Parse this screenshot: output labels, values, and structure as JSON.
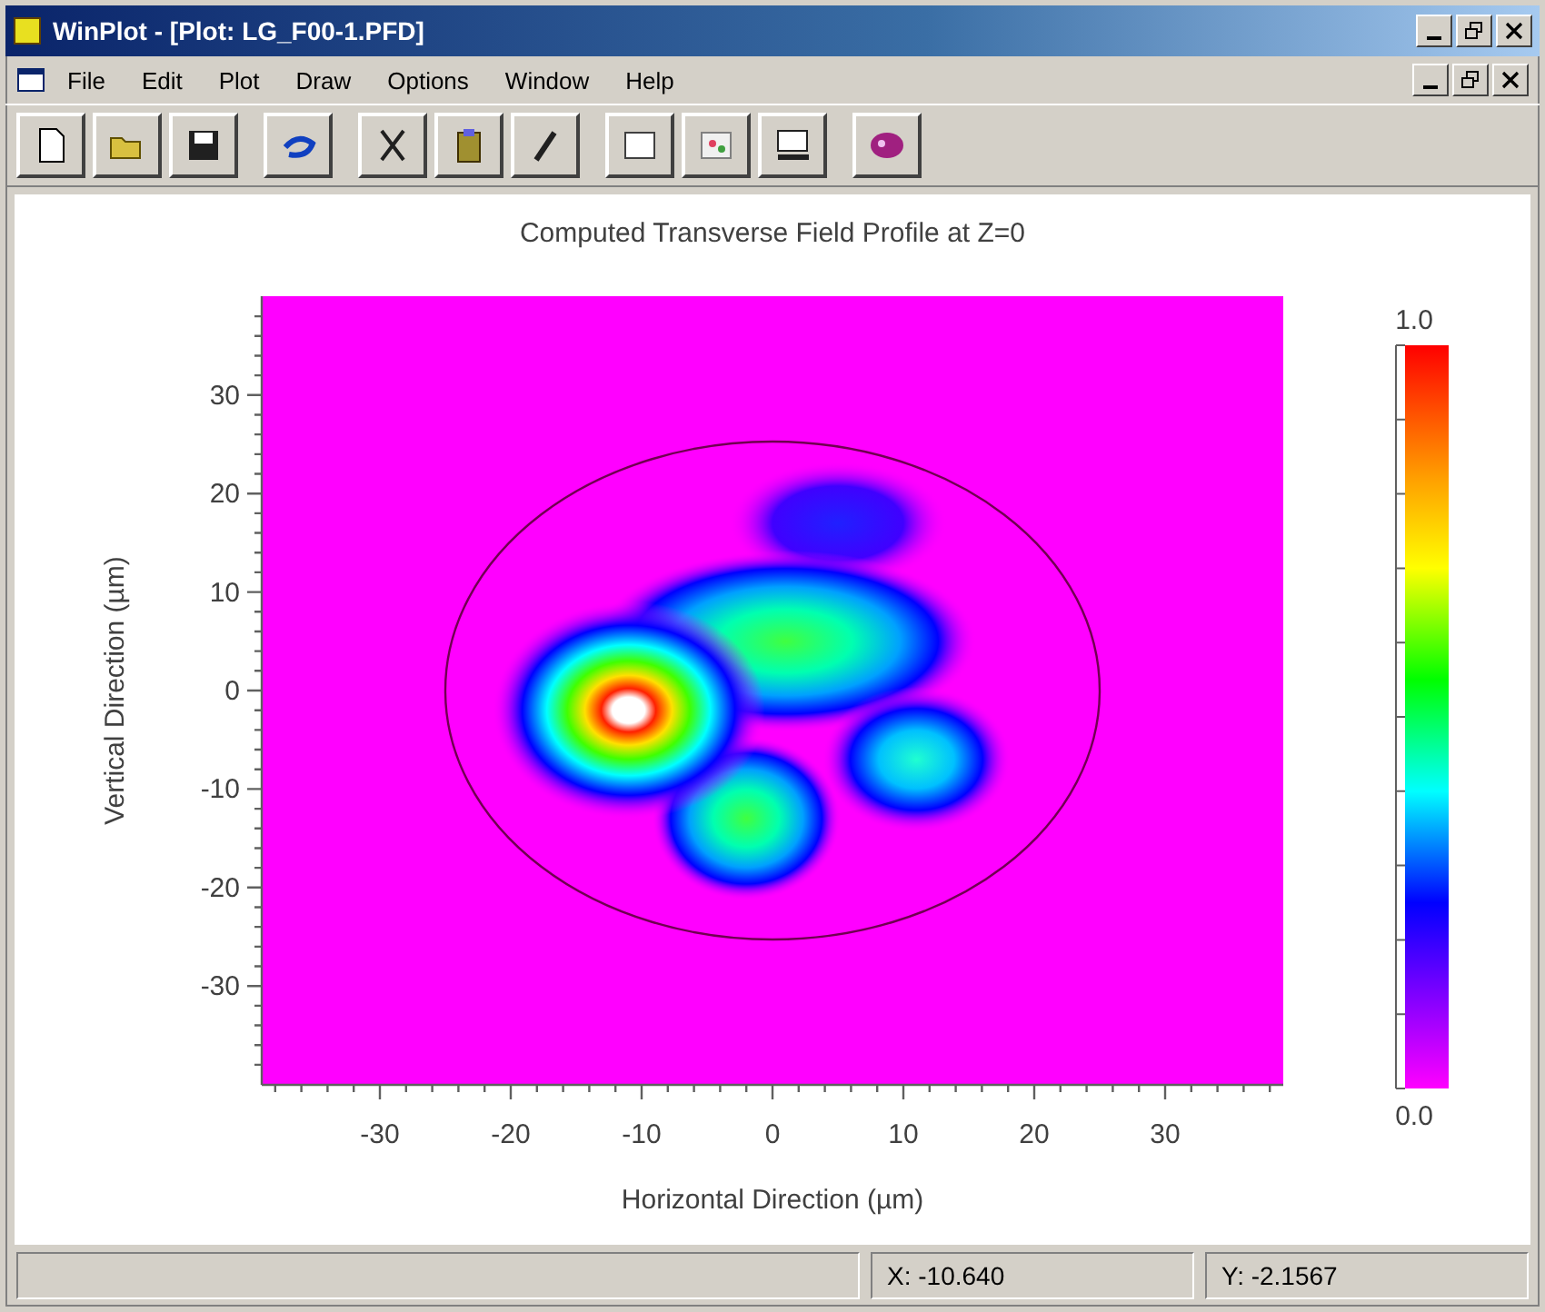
{
  "window": {
    "title": "WinPlot - [Plot: LG_F00-1.PFD]"
  },
  "menu": [
    "File",
    "Edit",
    "Plot",
    "Draw",
    "Options",
    "Window",
    "Help"
  ],
  "toolbar": [
    [
      {
        "kind": "new"
      },
      {
        "kind": "open"
      },
      {
        "kind": "save"
      }
    ],
    [
      {
        "kind": "undo"
      }
    ],
    [
      {
        "kind": "cut"
      },
      {
        "kind": "paste"
      },
      {
        "kind": "brush"
      }
    ],
    [
      {
        "kind": "window"
      },
      {
        "kind": "chart"
      },
      {
        "kind": "monitor"
      }
    ],
    [
      {
        "kind": "palette"
      }
    ]
  ],
  "plot": {
    "title": "Computed Transverse Field Profile at Z=0",
    "xlabel": "Horizontal Direction (µm)",
    "ylabel": "Vertical Direction (µm)",
    "xticks": [
      "-30",
      "-20",
      "-10",
      "0",
      "10",
      "20",
      "30"
    ],
    "yticks": [
      "30",
      "20",
      "10",
      "0",
      "-10",
      "-20",
      "-30"
    ],
    "colorbar": {
      "max": "1.0",
      "min": "0.0"
    }
  },
  "status_bar": [
    "X:  -10.640",
    "Y:  -2.1567"
  ]
}
